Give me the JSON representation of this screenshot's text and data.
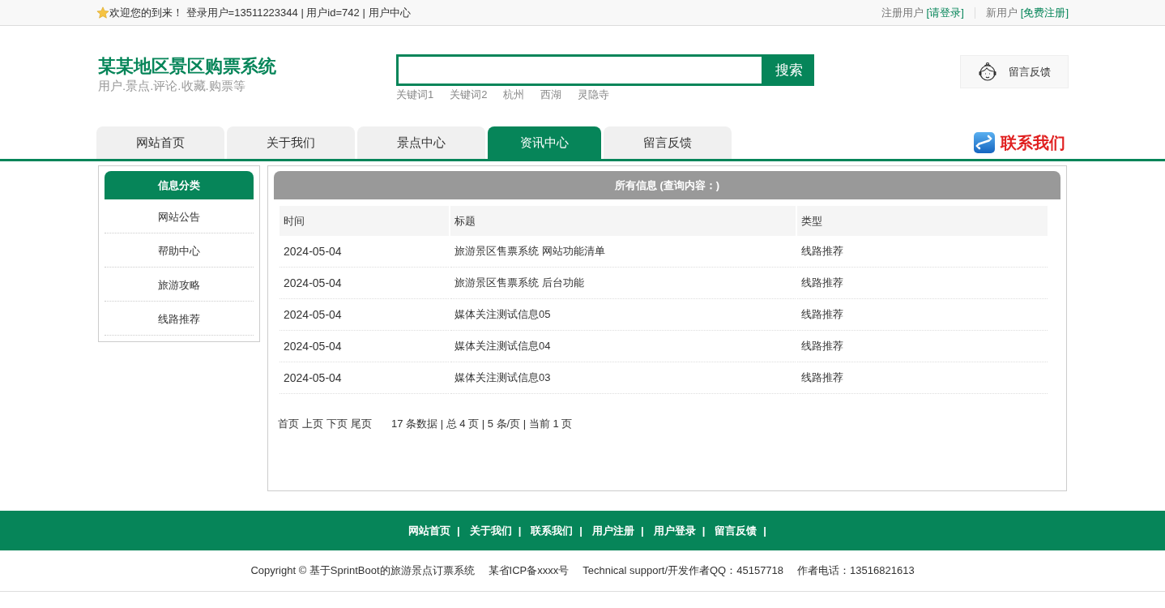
{
  "top_bar": {
    "welcome": "欢迎您的到来！ 登录用户=13511223344 | 用户id=742 |",
    "user_center_link": "用户中心",
    "registered_label": "注册用户",
    "login_link": "[请登录]",
    "new_user_label": "新用户",
    "register_link": "[免费注册]"
  },
  "header": {
    "title": "某某地区景区购票系统",
    "subtitle": "用户.景点.评论.收藏.购票等",
    "search_button": "搜索",
    "keywords": [
      "关键词1",
      "关键词2",
      "杭州",
      "西湖",
      "灵隐寺"
    ],
    "feedback_button": "留言反馈"
  },
  "nav": {
    "tabs": [
      {
        "label": "网站首页",
        "selected": false
      },
      {
        "label": "关于我们",
        "selected": false
      },
      {
        "label": "景点中心",
        "selected": false
      },
      {
        "label": "资讯中心",
        "selected": true
      },
      {
        "label": "留言反馈",
        "selected": false
      }
    ],
    "contact": "联系我们"
  },
  "sidebar": {
    "title": "信息分类",
    "items": [
      "网站公告",
      "帮助中心",
      "旅游攻略",
      "线路推荐"
    ]
  },
  "main": {
    "title": "所有信息 (查询内容：)",
    "columns": [
      "时间",
      "标题",
      "类型"
    ],
    "rows": [
      [
        "2024-05-04",
        "旅游景区售票系统 网站功能清单",
        "线路推荐"
      ],
      [
        "2024-05-04",
        "旅游景区售票系统 后台功能",
        "线路推荐"
      ],
      [
        "2024-05-04",
        "媒体关注测试信息05",
        "线路推荐"
      ],
      [
        "2024-05-04",
        "媒体关注测试信息04",
        "线路推荐"
      ],
      [
        "2024-05-04",
        "媒体关注测试信息03",
        "线路推荐"
      ]
    ],
    "pagination": {
      "links": [
        "首页",
        "上页",
        "下页",
        "尾页"
      ],
      "summary": "17 条数据 | 总 4 页 | 5 条/页 | 当前 1 页"
    }
  },
  "footer": {
    "links": [
      {
        "label": "网站首页",
        "separator": "|"
      },
      {
        "label": "关于我们",
        "separator": "|"
      },
      {
        "label": "联系我们",
        "separator": "|"
      },
      {
        "label": "用户注册",
        "separator": "|"
      },
      {
        "label": "用户登录",
        "separator": "|"
      },
      {
        "label": "留言反馈",
        "separator": "|"
      }
    ],
    "copyright": [
      "Copyright © 基于SprintBoot的旅游景点订票系统",
      "某省ICP备xxxx号",
      "Technical support/开发作者QQ：45157718",
      "作者电话：13516821613"
    ]
  }
}
